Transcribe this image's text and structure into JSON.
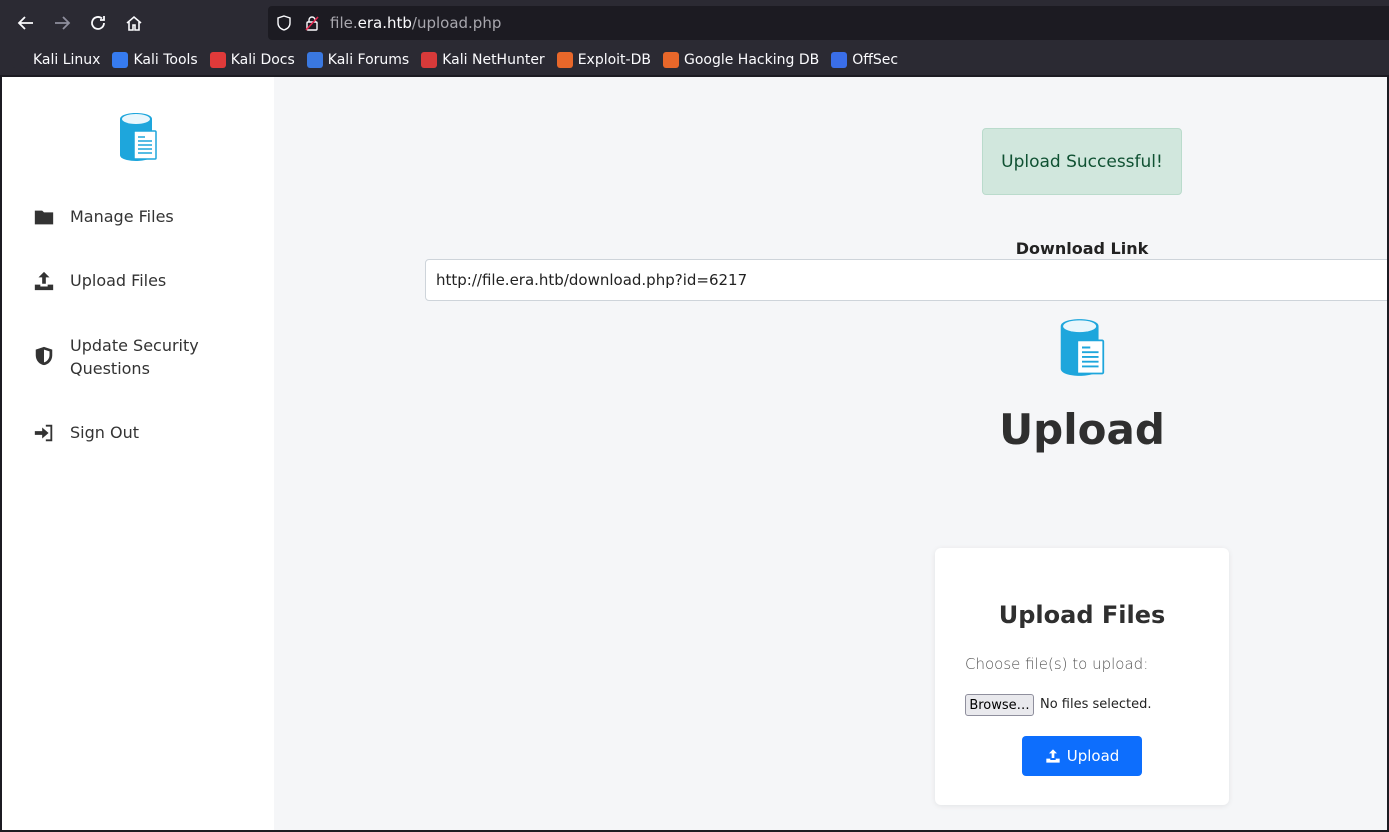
{
  "browser": {
    "url_prefix": "file.",
    "url_host": "era.htb",
    "url_path": "/upload.php",
    "bookmarks": [
      {
        "label": "Kali Linux",
        "icon": "kali-dragon-icon",
        "color": "#2b2a33"
      },
      {
        "label": "Kali Tools",
        "icon": "kali-tools-icon",
        "color": "#367bf0"
      },
      {
        "label": "Kali Docs",
        "icon": "kali-docs-icon",
        "color": "#e03a3a"
      },
      {
        "label": "Kali Forums",
        "icon": "kali-forums-icon",
        "color": "#3a78e0"
      },
      {
        "label": "Kali NetHunter",
        "icon": "kali-nethunter-icon",
        "color": "#d83a3a"
      },
      {
        "label": "Exploit-DB",
        "icon": "exploit-db-icon",
        "color": "#e8672a"
      },
      {
        "label": "Google Hacking DB",
        "icon": "ghdb-icon",
        "color": "#e8672a"
      },
      {
        "label": "OffSec",
        "icon": "offsec-icon",
        "color": "#3a6ee8"
      }
    ]
  },
  "sidebar": {
    "items": [
      {
        "label": "Manage Files",
        "icon": "folder-icon"
      },
      {
        "label": "Upload Files",
        "icon": "upload-icon"
      },
      {
        "label": "Update Security Questions",
        "icon": "shield-icon"
      },
      {
        "label": "Sign Out",
        "icon": "sign-out-icon"
      }
    ]
  },
  "main": {
    "alert": "Upload Successful!",
    "download_label": "Download Link",
    "download_url": "http://file.era.htb/download.php?id=6217",
    "title": "Upload",
    "card": {
      "heading": "Upload Files",
      "choose_label": "Choose file(s) to upload:",
      "browse_label": "Browse…",
      "no_file": "No files selected.",
      "upload_button": "Upload"
    }
  },
  "colors": {
    "accent": "#0d6efd",
    "logo": "#1ea6dc",
    "alert_bg": "#d1e7dd",
    "alert_text": "#0f5132"
  }
}
